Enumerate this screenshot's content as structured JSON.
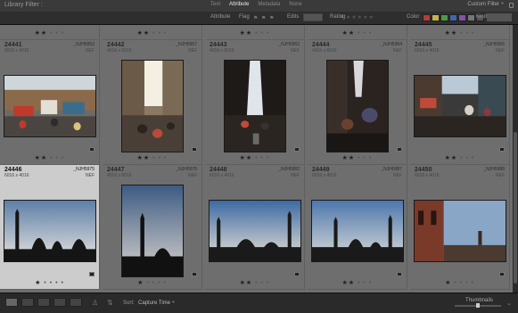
{
  "filter_bar": {
    "title": "Library Filter :",
    "tabs": [
      {
        "label": "Text",
        "active": false
      },
      {
        "label": "Attribute",
        "active": true
      },
      {
        "label": "Metadata",
        "active": false
      },
      {
        "label": "None",
        "active": false
      }
    ],
    "preset": "Custom Filter ÷"
  },
  "attribute_bar": {
    "attribute_label": "Attribute",
    "flag_label": "Flag",
    "edits_label": "Edits",
    "rating_label": "Rating",
    "rating_op": "≥",
    "rating_stars": "★★★★★",
    "color_label": "Color",
    "kind_label": "Kind",
    "colors": [
      "#b83a3a",
      "#c9b24a",
      "#4f9a45",
      "#3d68b0",
      "#8a4fa8",
      "#777777",
      "#555555"
    ]
  },
  "rows": [
    {
      "partial": true,
      "cells": [
        {
          "rating": "★★",
          "rest": "• • •"
        },
        {
          "rating": "★★",
          "rest": "• • •"
        },
        {
          "rating": "★★",
          "rest": "• • •"
        },
        {
          "rating": "★★",
          "rest": "• • •"
        },
        {
          "rating": "★★",
          "rest": "• • •"
        }
      ]
    },
    {
      "cells": [
        {
          "num": "24441",
          "fname": "_NJH5952",
          "dims": "6016 x 4016",
          "ext": "NEF",
          "rating": "★★",
          "rest": "• • •",
          "scene": "market",
          "orientation": "landscape"
        },
        {
          "num": "24442",
          "fname": "_NJH5957",
          "dims": "4016 x 6016",
          "ext": "NEF",
          "rating": "★★",
          "rest": "• • •",
          "scene": "street-light",
          "orientation": "portrait"
        },
        {
          "num": "24443",
          "fname": "_NJH5962",
          "dims": "4016 x 6016",
          "ext": "NEF",
          "rating": "★★",
          "rest": "• • •",
          "scene": "alley-dark",
          "orientation": "portrait"
        },
        {
          "num": "24444",
          "fname": "_NJH5964",
          "dims": "4016 x 6016",
          "ext": "NEF",
          "rating": "★★",
          "rest": "• • •",
          "scene": "alley-people",
          "orientation": "portrait"
        },
        {
          "num": "24445",
          "fname": "_NJH5965",
          "dims": "6016 x 4016",
          "ext": "NEF",
          "rating": "★★",
          "rest": "• • •",
          "scene": "bazaar",
          "orientation": "landscape"
        }
      ]
    },
    {
      "cells": [
        {
          "num": "24446",
          "fname": "_NJH5975",
          "dims": "6016 x 4016",
          "ext": "NEF",
          "rating": "★",
          "rest": "• • • •",
          "scene": "mosque-sil",
          "orientation": "landscape",
          "selected": true
        },
        {
          "num": "24447",
          "fname": "_NJH5976",
          "dims": "4016 x 6016",
          "ext": "NEF",
          "rating": "★",
          "rest": "• • • •",
          "scene": "mosque-portrait",
          "orientation": "portrait"
        },
        {
          "num": "24448",
          "fname": "_NJH5982",
          "dims": "6016 x 4016",
          "ext": "NEF",
          "rating": "★★",
          "rest": "• • •",
          "scene": "mosque-sky",
          "orientation": "landscape"
        },
        {
          "num": "24449",
          "fname": "_NJH5987",
          "dims": "6016 x 4016",
          "ext": "NEF",
          "rating": "★★",
          "rest": "• • •",
          "scene": "mosque-sky2",
          "orientation": "landscape"
        },
        {
          "num": "24450",
          "fname": "_NJH5988",
          "dims": "6016 x 4016",
          "ext": "NEF",
          "rating": "★",
          "rest": "• • • •",
          "scene": "fort",
          "orientation": "landscape"
        }
      ]
    }
  ],
  "toolbar": {
    "sort_label": "Sort:",
    "sort_value": "Capture Time ÷",
    "thumbnails_label": "Thumbnails",
    "thumb_size": 0.5
  }
}
